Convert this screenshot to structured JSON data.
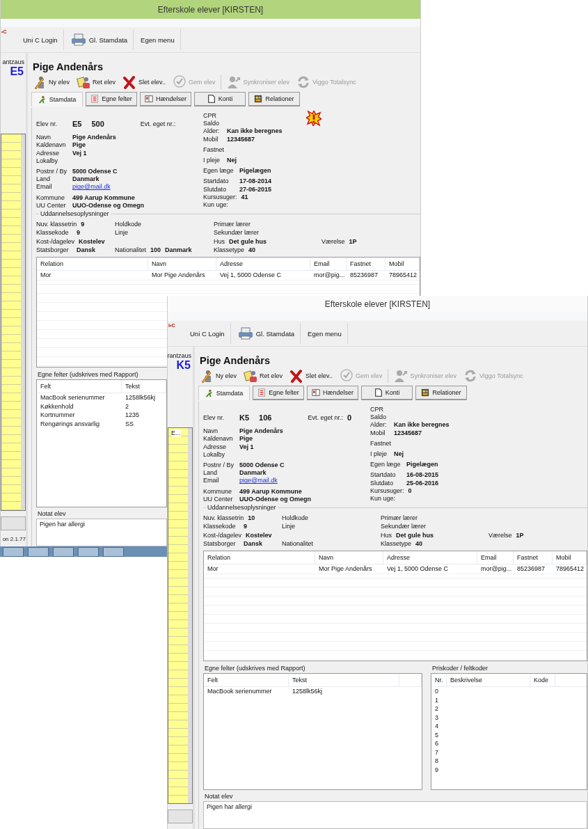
{
  "windows": [
    {
      "title": "Efterskole elever [KIRSTEN]",
      "active": true,
      "toolbar": {
        "logo": "•C",
        "items": [
          {
            "label": "Uni C Login"
          },
          {
            "label": "Gl. Stamdata"
          },
          {
            "label": "Egen menu"
          }
        ]
      },
      "sidebar": {
        "school": "antzaus",
        "code": "E5",
        "version": "on 2.1.77"
      },
      "student_name": "Pige Andenårs",
      "actions": [
        {
          "label": "Ny elev",
          "disabled": false
        },
        {
          "label": "Ret elev",
          "disabled": false
        },
        {
          "label": "Slet elev..",
          "disabled": false
        },
        {
          "label": "Gem elev",
          "disabled": true
        },
        {
          "label": "Synkroniser elev",
          "disabled": true
        },
        {
          "label": "Viggo Totalsync",
          "disabled": true
        }
      ],
      "tabs": [
        {
          "label": "Stamdata",
          "selected": true
        },
        {
          "label": "Egne felter",
          "selected": false
        },
        {
          "label": "Hændelser",
          "selected": false
        },
        {
          "label": "Konti",
          "selected": false
        },
        {
          "label": "Relationer",
          "selected": false
        }
      ],
      "alert": true,
      "stamdata": {
        "elev_nr": {
          "label": "Elev nr.",
          "values": [
            "E5",
            "500"
          ]
        },
        "own_nr": {
          "label": "Evt. eget nr.:"
        },
        "left_groups": [
          [
            {
              "label": "Navn",
              "values": [
                "Pige Andenårs"
              ],
              "kind": "text"
            },
            {
              "label": "Kaldenavn",
              "values": [
                "Pige"
              ],
              "kind": "text"
            },
            {
              "label": "Adresse",
              "values": [
                "Vej 1"
              ],
              "kind": "text"
            },
            {
              "label": "Lokalby"
            }
          ],
          [
            {
              "label": "Postnr / By",
              "values": [
                "5000 Odense C"
              ],
              "kind": "text"
            },
            {
              "label": "Land",
              "values": [
                "Danmark"
              ],
              "kind": "text"
            },
            {
              "label": "Email",
              "values": [
                "pige@mail.dk"
              ],
              "kind": "link"
            }
          ],
          [
            {
              "label": "Kommune",
              "values": [
                "499 Aarup Kommune"
              ],
              "kind": "text"
            },
            {
              "label": "UU Center",
              "values": [
                "UUO-Odense og Omegn"
              ],
              "kind": "text"
            }
          ]
        ],
        "right_groups": [
          [
            {
              "label": "CPR"
            },
            {
              "label": "Saldo"
            },
            {
              "label": "Alder:",
              "values": [
                "Kan ikke beregnes"
              ]
            },
            {
              "label": "Mobil",
              "values": [
                "12345687"
              ]
            }
          ],
          [
            {
              "label": "Fastnet"
            }
          ],
          [
            {
              "label": "I pleje",
              "values": [
                "Nej"
              ]
            }
          ],
          [
            {
              "label": "Egen læge",
              "values": [
                "Pigelægen"
              ]
            }
          ],
          [
            {
              "label": "Startdato",
              "values": [
                "17-08-2014"
              ]
            },
            {
              "label": "Slutdato",
              "values": [
                "27-06-2015"
              ]
            },
            {
              "label": "Kursusuger:",
              "values": [
                "41"
              ]
            },
            {
              "label": "Kun uge:"
            }
          ]
        ]
      },
      "education": {
        "title": "Uddannelsesoplysninger",
        "rows": [
          {
            "col_1": {
              "label": "Nuv. klassetrin",
              "values": [
                "9"
              ]
            },
            "col_2": {
              "label": "Holdkode"
            },
            "col_3": {
              "label": "Primær lærer"
            }
          },
          {
            "col_1": {
              "label": "Klassekode",
              "values": [
                "9"
              ]
            },
            "col_2": {
              "label": "Linje"
            },
            "col_3": {
              "label": "Sekundær lærer"
            }
          },
          {
            "col_1": {
              "label": "Kost-/dagelev",
              "values": [
                "Kostelev"
              ]
            },
            "col_3": {
              "label": "Hus",
              "values": [
                "Det gule hus"
              ]
            },
            "col_4": {
              "label": "Værelse",
              "values": [
                "1P"
              ]
            }
          },
          {
            "col_1": {
              "label": "Statsborger",
              "values": [
                "Dansk"
              ]
            },
            "col_2": {
              "label": "Nationalitet",
              "values": [
                "100",
                "Danmark"
              ]
            },
            "col_3": {
              "label": "Klassetype",
              "values": [
                "40"
              ]
            }
          }
        ]
      },
      "relations": {
        "columns": [
          "Relation",
          "Navn",
          "Adresse",
          "Email",
          "Fastnet",
          "Mobil"
        ],
        "rows": [
          [
            "Mor",
            "Mor Pige Andenårs",
            "Vej 1, 5000 Odense C",
            "mor@pig...",
            "85236987",
            "78965412"
          ]
        ]
      },
      "own_fields": {
        "title": "Egne felter (udskrives med Rapport)",
        "columns": [
          "Felt",
          "Tekst"
        ],
        "rows": [
          [
            "MacBook serienummer",
            "1258lk56kj"
          ],
          [
            "Køkkenhold",
            "2"
          ],
          [
            "Kortnummer",
            "1235"
          ],
          [
            "Rengørings ansvarlig",
            "SS"
          ]
        ]
      },
      "note": {
        "title": "Notat elev",
        "text": "Pigen har allergi"
      }
    },
    {
      "title": "Efterskole elever [KIRSTEN]",
      "active": false,
      "toolbar": {
        "logo": "I•C",
        "items": [
          {
            "label": "Uni C Login"
          },
          {
            "label": "Gl. Stamdata"
          },
          {
            "label": "Egen menu"
          }
        ]
      },
      "sidebar": {
        "school": "rantzaus",
        "code": "K5",
        "list_header": "E..."
      },
      "student_name": "Pige Andenårs",
      "actions": [
        {
          "label": "Ny elev",
          "disabled": false
        },
        {
          "label": "Ret elev",
          "disabled": false
        },
        {
          "label": "Slet elev..",
          "disabled": false
        },
        {
          "label": "Gem elev",
          "disabled": true
        },
        {
          "label": "Synkroniser elev",
          "disabled": true
        },
        {
          "label": "Viggo Totalsync",
          "disabled": true
        }
      ],
      "tabs": [
        {
          "label": "Stamdata",
          "selected": true
        },
        {
          "label": "Egne felter",
          "selected": false
        },
        {
          "label": "Hændelser",
          "selected": false
        },
        {
          "label": "Konti",
          "selected": false
        },
        {
          "label": "Relationer",
          "selected": false
        }
      ],
      "alert": false,
      "stamdata": {
        "elev_nr": {
          "label": "Elev nr.",
          "values": [
            "K5",
            "106"
          ]
        },
        "own_nr": {
          "label": "Evt. eget nr.:",
          "values": [
            "0"
          ]
        },
        "left_groups": [
          [
            {
              "label": "Navn",
              "values": [
                "Pige Andenårs"
              ],
              "kind": "text"
            },
            {
              "label": "Kaldenavn",
              "values": [
                "Pige"
              ],
              "kind": "text"
            },
            {
              "label": "Adresse",
              "values": [
                "Vej 1"
              ],
              "kind": "text"
            },
            {
              "label": "Lokalby"
            }
          ],
          [
            {
              "label": "Postnr / By",
              "values": [
                "5000 Odense C"
              ],
              "kind": "text"
            },
            {
              "label": "Land",
              "values": [
                "Danmark"
              ],
              "kind": "text"
            },
            {
              "label": "Email",
              "values": [
                "pige@mail.dk"
              ],
              "kind": "link"
            }
          ],
          [
            {
              "label": "Kommune",
              "values": [
                "499 Aarup Kommune"
              ],
              "kind": "text"
            },
            {
              "label": "UU Center",
              "values": [
                "UUO-Odense og Omegn"
              ],
              "kind": "text"
            }
          ]
        ],
        "right_groups": [
          [
            {
              "label": "CPR"
            },
            {
              "label": "Saldo"
            },
            {
              "label": "Alder:",
              "values": [
                "Kan ikke beregnes"
              ]
            },
            {
              "label": "Mobil",
              "values": [
                "12345687"
              ]
            }
          ],
          [
            {
              "label": "Fastnet"
            }
          ],
          [
            {
              "label": "I pleje",
              "values": [
                "Nej"
              ]
            }
          ],
          [
            {
              "label": "Egen læge",
              "values": [
                "Pigelægen"
              ]
            }
          ],
          [
            {
              "label": "Startdato",
              "values": [
                "16-08-2015"
              ]
            },
            {
              "label": "Slutdato",
              "values": [
                "25-06-2016"
              ]
            },
            {
              "label": "Kursusuger:",
              "values": [
                "0"
              ]
            },
            {
              "label": "Kun uge:"
            }
          ]
        ]
      },
      "education": {
        "title": "Uddannelsesoplysninger",
        "rows": [
          {
            "col_1": {
              "label": "Nuv. klassetrin",
              "values": [
                "10"
              ]
            },
            "col_2": {
              "label": "Holdkode"
            },
            "col_3": {
              "label": "Primær lærer"
            }
          },
          {
            "col_1": {
              "label": "Klassekode",
              "values": [
                "9"
              ]
            },
            "col_2": {
              "label": "Linje"
            },
            "col_3": {
              "label": "Sekundær lærer"
            }
          },
          {
            "col_1": {
              "label": "Kost-/dagelev",
              "values": [
                "Kostelev"
              ]
            },
            "col_3": {
              "label": "Hus",
              "values": [
                "Det gule hus"
              ]
            },
            "col_4": {
              "label": "Værelse",
              "values": [
                "1P"
              ]
            }
          },
          {
            "col_1": {
              "label": "Statsborger",
              "values": [
                "Dansk"
              ]
            },
            "col_2": {
              "label": "Nationalitet"
            },
            "col_3": {
              "label": "Klassetype",
              "values": [
                "40"
              ]
            }
          }
        ]
      },
      "relations": {
        "columns": [
          "Relation",
          "Navn",
          "Adresse",
          "Email",
          "Fastnet",
          "Mobil"
        ],
        "rows": [
          [
            "Mor",
            "Mor Pige Andenårs",
            "Vej 1, 5000 Odense C",
            "mor@pig...",
            "85236987",
            "78965412"
          ]
        ]
      },
      "own_fields": {
        "title": "Egne felter (udskrives med Rapport)",
        "columns": [
          "Felt",
          "Tekst"
        ],
        "rows": [
          [
            "MacBook serienummer",
            "1258lk56kj"
          ]
        ]
      },
      "price_codes": {
        "title": "Priskoder / feltkoder",
        "columns": [
          "Nr.",
          "Beskrivelse",
          "Kode"
        ],
        "rows": [
          [
            "0"
          ],
          [
            "1"
          ],
          [
            "2"
          ],
          [
            "3"
          ],
          [
            "4"
          ],
          [
            "5"
          ],
          [
            "6"
          ],
          [
            "7"
          ],
          [
            "8"
          ],
          [
            "9"
          ]
        ]
      },
      "note": {
        "title": "Notat elev",
        "text": "Pigen har allergi"
      }
    }
  ]
}
